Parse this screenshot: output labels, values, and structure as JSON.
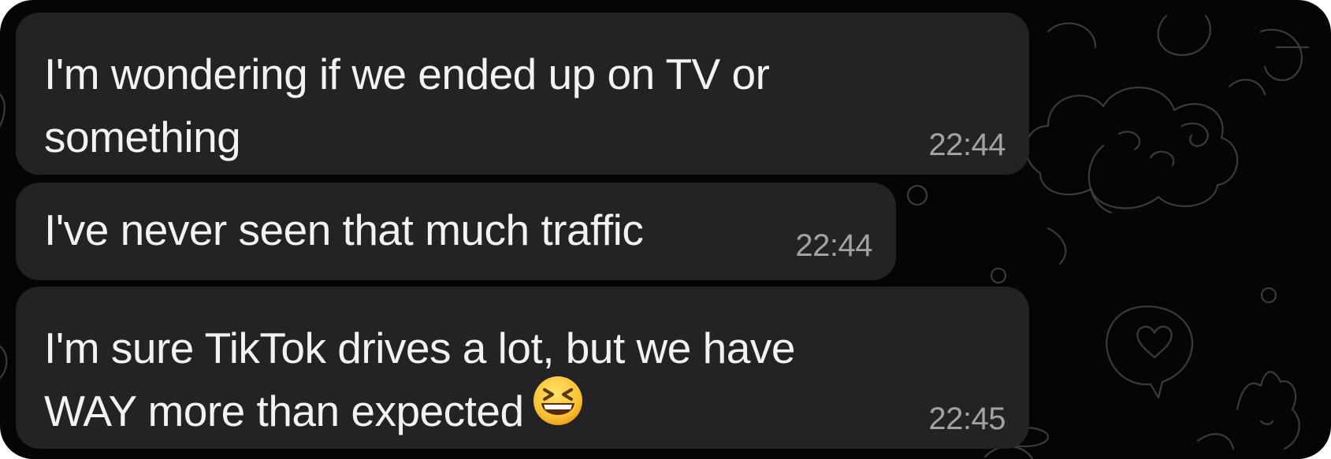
{
  "messages": [
    {
      "line1": "I'm wondering if we ended up on TV or",
      "line2": "something",
      "time": "22:44"
    },
    {
      "line1": "I've never seen that much traffic",
      "time": "22:44"
    },
    {
      "line1": "I'm sure TikTok drives a lot, but we have",
      "line2": "WAY more than expected",
      "emoji": "grinning-squinting-face",
      "time": "22:45"
    }
  ],
  "colors": {
    "background": "#050505",
    "bubble": "#232224",
    "text": "#f2f2f2",
    "timestamp": "#a2a1a3",
    "doodle": "#3d3a3d"
  }
}
